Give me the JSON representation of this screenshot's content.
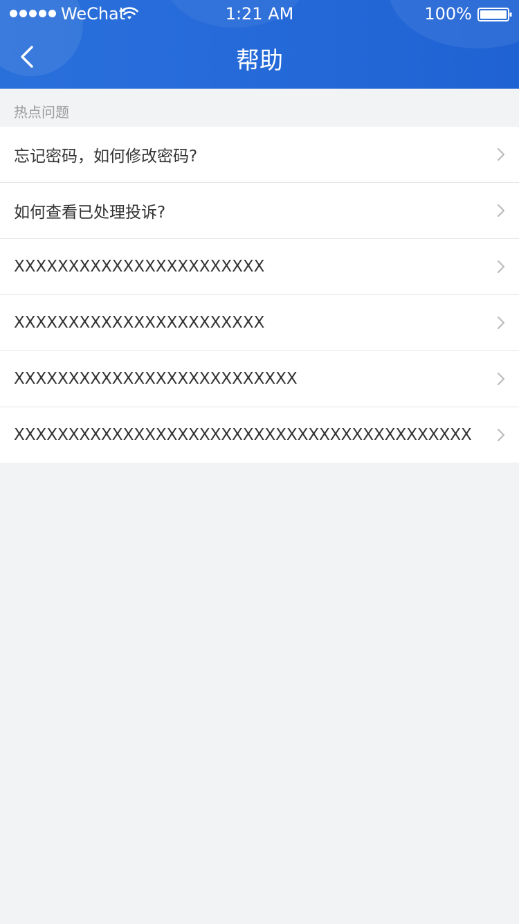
{
  "status_bar": {
    "carrier": "WeChat",
    "time": "1:21 AM",
    "battery": "100%"
  },
  "header": {
    "title": "帮助"
  },
  "section": {
    "title": "热点问题"
  },
  "items": [
    {
      "label": "忘记密码，如何修改密码?"
    },
    {
      "label": "如何查看已处理投诉?"
    },
    {
      "label": "XXXXXXXXXXXXXXXXXXXXXXX"
    },
    {
      "label": "XXXXXXXXXXXXXXXXXXXXXXX"
    },
    {
      "label": "XXXXXXXXXXXXXXXXXXXXXXXXXX"
    },
    {
      "label": "XXXXXXXXXXXXXXXXXXXXXXXXXXXXXXXXXXXXXXXXXX"
    }
  ],
  "colors": {
    "header_bg": "#2468d8",
    "page_bg": "#f2f3f5",
    "text": "#333333",
    "muted": "#9a9a9a"
  }
}
